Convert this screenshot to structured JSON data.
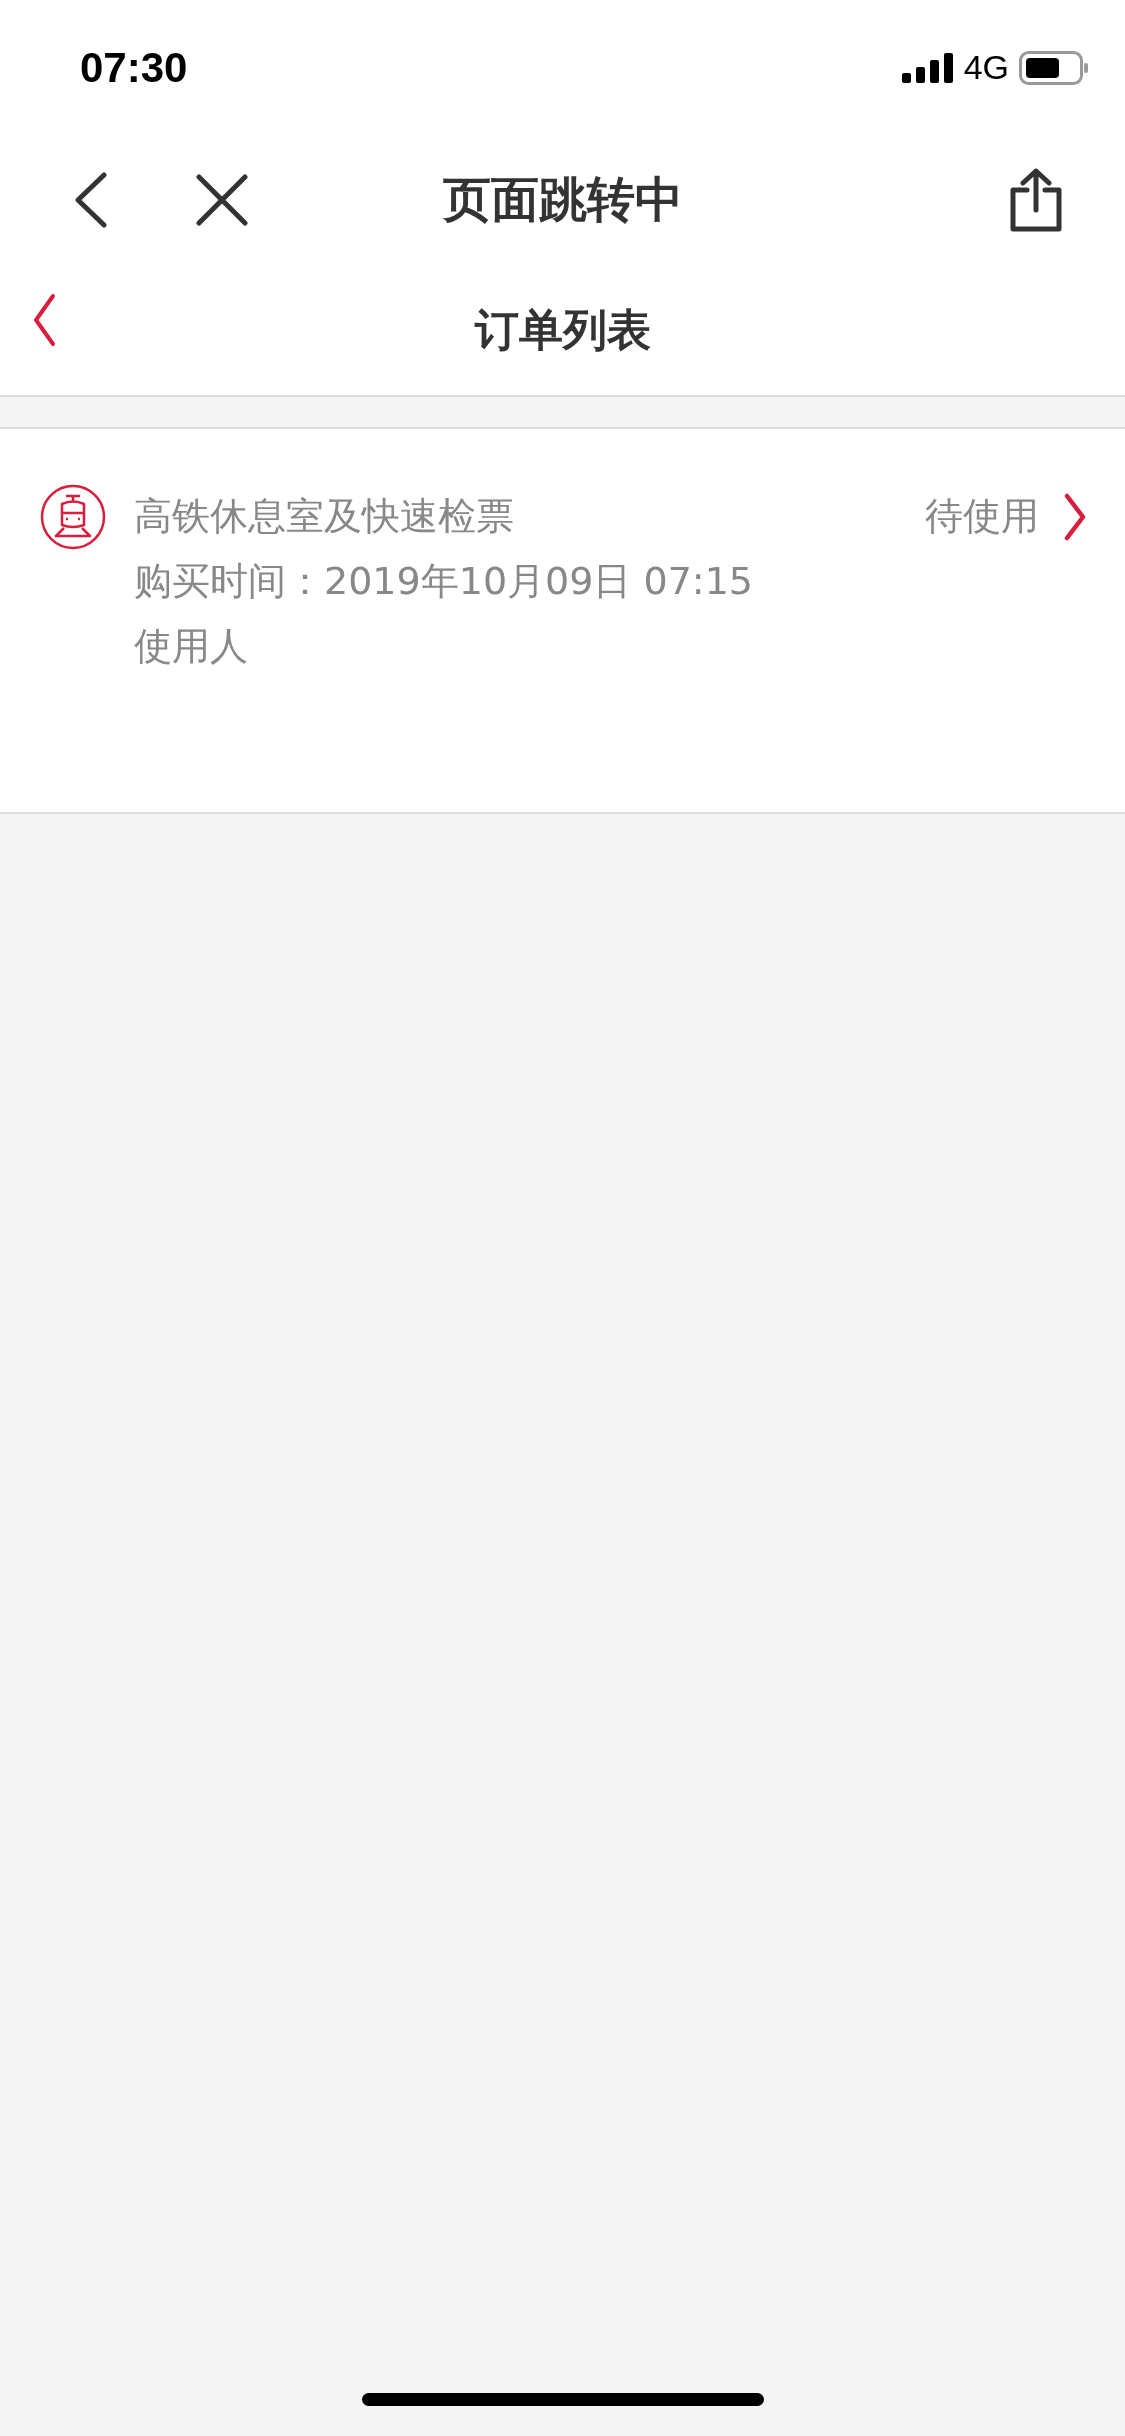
{
  "status_bar": {
    "time": "07:30",
    "network": "4G"
  },
  "browser_bar": {
    "title": "页面跳转中"
  },
  "header": {
    "title": "订单列表"
  },
  "orders": [
    {
      "title": "高铁休息室及快速检票",
      "purchase_time": "购买时间：2019年10月09日 07:15",
      "user": "使用人",
      "status": "待使用"
    }
  ]
}
